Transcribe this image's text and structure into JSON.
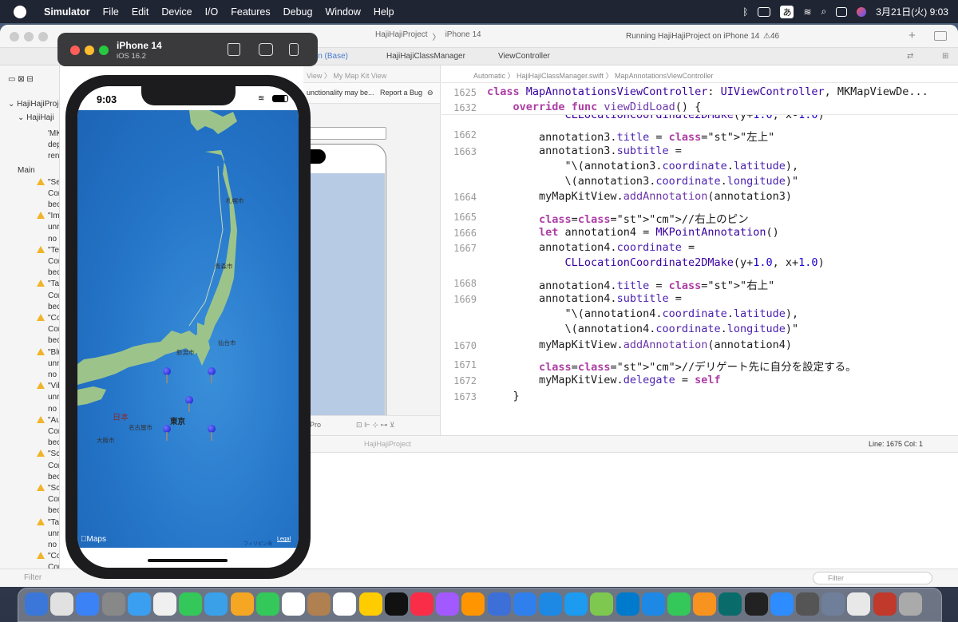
{
  "menubar": {
    "app": "Simulator",
    "items": [
      "File",
      "Edit",
      "Device",
      "I/O",
      "Features",
      "Debug",
      "Window",
      "Help"
    ],
    "ime": "あ",
    "datetime": "3月21日(火)  9:03"
  },
  "xcode": {
    "scheme": "HajiHajiProject",
    "device": "iPhone 14",
    "running": "Running HajiHajiProject on iPhone 14",
    "warnings": "⚠46",
    "tabs": [
      "in (Base)",
      "HajiHajiClassManager",
      "ViewController"
    ],
    "navigator": {
      "project": "HajiHajiProject",
      "target": "HajiHaji",
      "items": [
        {
          "t": "'MK",
          "w": false
        },
        {
          "t": "depr",
          "w": false
        },
        {
          "t": "rena",
          "w": false
        },
        {
          "t": "Main",
          "w": false
        },
        {
          "t": "\"Se",
          "w": true
        },
        {
          "t": "Cor",
          "w": false
        },
        {
          "t": "beca",
          "w": false
        },
        {
          "t": "\"Ima",
          "w": true
        },
        {
          "t": "unre",
          "w": false
        },
        {
          "t": "no e",
          "w": false
        },
        {
          "t": "\"Te",
          "w": true
        },
        {
          "t": "Con",
          "w": false
        },
        {
          "t": "beca",
          "w": false
        },
        {
          "t": "\"Tal",
          "w": true
        },
        {
          "t": "Con",
          "w": false
        },
        {
          "t": "beca",
          "w": false
        },
        {
          "t": "\"Cor",
          "w": true
        },
        {
          "t": "Con",
          "w": false
        },
        {
          "t": "beca",
          "w": false
        },
        {
          "t": "\"Blu",
          "w": true
        },
        {
          "t": "unre",
          "w": false
        },
        {
          "t": "no e",
          "w": false
        },
        {
          "t": "\"Vib",
          "w": true
        },
        {
          "t": "unre",
          "w": false
        },
        {
          "t": "no e",
          "w": false
        },
        {
          "t": "\"Aut",
          "w": true
        },
        {
          "t": "Con",
          "w": false
        },
        {
          "t": "beca",
          "w": false
        },
        {
          "t": "\"Scr",
          "w": true
        },
        {
          "t": "Con",
          "w": false
        },
        {
          "t": "beca",
          "w": false
        },
        {
          "t": "\"Scr",
          "w": true
        },
        {
          "t": "Con",
          "w": false
        },
        {
          "t": "beca",
          "w": false
        },
        {
          "t": "\"Tab",
          "w": true
        },
        {
          "t": "unre",
          "w": false
        },
        {
          "t": "no e",
          "w": false
        },
        {
          "t": "\"Col",
          "w": true
        },
        {
          "t": "Con",
          "w": false
        },
        {
          "t": "beca",
          "w": false
        },
        {
          "t": "Data D",
          "w": false
        }
      ]
    },
    "ib": {
      "crumb": "View 〉 My Map Kit View",
      "report_text": "unctionality may be...",
      "report_btn": "Report a Bug",
      "device_label": "Pro"
    },
    "editor": {
      "crumb": "Automatic 〉 HajiHajiClassManager.swift 〉 MapAnnotationsViewController",
      "sticky": [
        {
          "n": "1625",
          "t": "class MapAnnotationsViewController: UIViewController, MKMapViewDe..."
        },
        {
          "n": "1632",
          "t": "    override func viewDidLoad() {"
        }
      ],
      "lines": [
        {
          "n": "",
          "t": "            CLLocationCoordinate2DMake(y+1.0, x-1.0)"
        },
        {
          "n": "1662",
          "t": "        annotation3.title = \"左上\""
        },
        {
          "n": "1663",
          "t": "        annotation3.subtitle ="
        },
        {
          "n": "",
          "t": "            \"\\(annotation3.coordinate.latitude),"
        },
        {
          "n": "",
          "t": "            \\(annotation3.coordinate.longitude)\""
        },
        {
          "n": "1664",
          "t": "        myMapKitView.addAnnotation(annotation3)"
        },
        {
          "n": "1665",
          "t": "        //右上のピン"
        },
        {
          "n": "1666",
          "t": "        let annotation4 = MKPointAnnotation()"
        },
        {
          "n": "1667",
          "t": "        annotation4.coordinate ="
        },
        {
          "n": "",
          "t": "            CLLocationCoordinate2DMake(y+1.0, x+1.0)"
        },
        {
          "n": "1668",
          "t": "        annotation4.title = \"右上\""
        },
        {
          "n": "1669",
          "t": "        annotation4.subtitle ="
        },
        {
          "n": "",
          "t": "            \"\\(annotation4.coordinate.latitude),"
        },
        {
          "n": "",
          "t": "            \\(annotation4.coordinate.longitude)\""
        },
        {
          "n": "1670",
          "t": "        myMapKitView.addAnnotation(annotation4)"
        },
        {
          "n": "1671",
          "t": "        //デリゲート先に自分を設定する。"
        },
        {
          "n": "1672",
          "t": "        myMapKitView.delegate = self"
        },
        {
          "n": "1673",
          "t": "    }"
        }
      ]
    },
    "status": {
      "project": "HajiHajiProject",
      "position": "Line: 1675  Col: 1"
    },
    "filter": "Filter"
  },
  "simulator": {
    "device": "iPhone 14",
    "os": "iOS 16.2",
    "time": "9:03",
    "map": {
      "cities": [
        "札幌市",
        "青森市",
        "仙台市",
        "新潟市",
        "東京",
        "名古屋市",
        "大阪市",
        "日本"
      ],
      "sea": "フィリピン海",
      "brand": "Maps",
      "legal": "Legal",
      "pin_count": 4
    }
  }
}
